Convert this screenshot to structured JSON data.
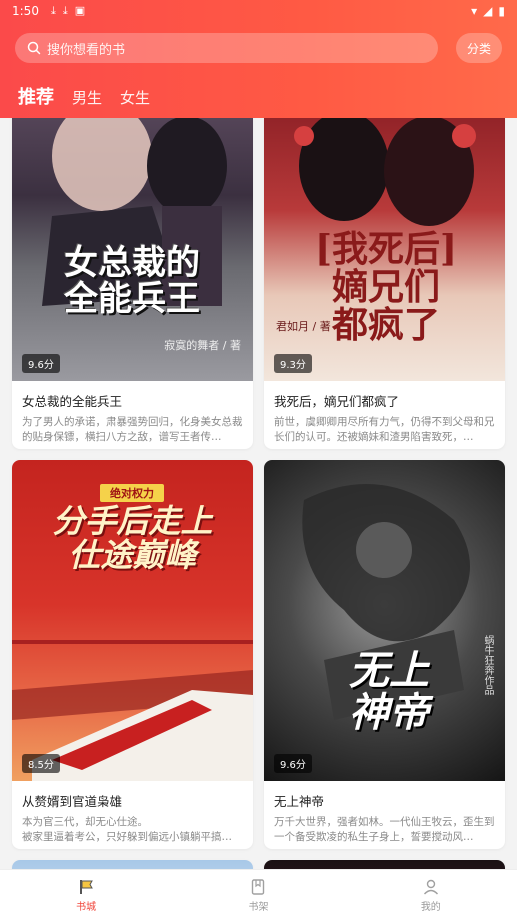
{
  "status_bar": {
    "time": "1:50"
  },
  "search": {
    "placeholder": "搜你想看的书",
    "category_label": "分类"
  },
  "tabs": [
    {
      "label": "推荐",
      "active": true
    },
    {
      "label": "男生",
      "active": false
    },
    {
      "label": "女生",
      "active": false
    }
  ],
  "books": [
    {
      "title": "女总裁的全能兵王",
      "score": "9.6分",
      "desc": "为了男人的承诺，肃暴强势回归，化身美女总裁的贴身保镖，横扫八方之敌，谱写王者传…",
      "cover_text": "女总裁的\n全能兵王",
      "cover_author": "寂寞的舞者 / 著"
    },
    {
      "title": "我死后，嫡兄们都疯了",
      "score": "9.3分",
      "desc": "前世，虞卿卿用尽所有力气，仍得不到父母和兄长们的认可。还被嫡妹和渣男陷害致死，…",
      "cover_text": "[我死后]\n嫡兄们\n都疯了",
      "cover_author": "君如月 / 著"
    },
    {
      "title": "从赘婿到官道枭雄",
      "score": "8.5分",
      "desc": "本为官三代，却无心仕途。\n被家里逼着考公，只好躲到偏远小镇躺平搞…",
      "cover_text": "分手后走上\n仕途巅峰",
      "cover_author": "绝对权力"
    },
    {
      "title": "无上神帝",
      "score": "9.6分",
      "desc": "万千大世界，强者如林。一代仙王牧云，歪生到一个备受欺凌的私生子身上，誓要搅动风…",
      "cover_text": "无上\n神帝",
      "cover_author": "蜗牛狂奔作品"
    }
  ],
  "bottom_nav": [
    {
      "label": "书城",
      "active": true,
      "icon": "bookstore-icon"
    },
    {
      "label": "书架",
      "active": false,
      "icon": "bookshelf-icon"
    },
    {
      "label": "我的",
      "active": false,
      "icon": "profile-icon"
    }
  ],
  "colors": {
    "accent": "#f0453a",
    "header_start": "#fb4a4a",
    "header_end": "#ff6a4a"
  }
}
